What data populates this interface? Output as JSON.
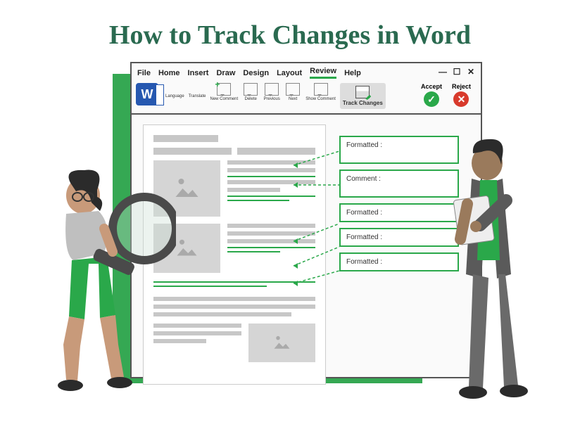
{
  "title": "How to Track Changes in Word",
  "menu": {
    "items": [
      "File",
      "Home",
      "Insert",
      "Draw",
      "Design",
      "Layout",
      "Review",
      "Help"
    ],
    "active_index": 6
  },
  "window_controls": {
    "min": "—",
    "max": "☐",
    "close": "✕"
  },
  "toolbar": {
    "logo_letter": "W",
    "language": "Language",
    "translate": "Translate",
    "new_comment": "New Comment",
    "delete": "Delete",
    "previous": "Previous",
    "next": "Next",
    "show_comment": "Show Comment",
    "track_changes": "Track Changes",
    "accept": "Accept",
    "reject": "Reject"
  },
  "balloons": [
    {
      "label": "Formatted :"
    },
    {
      "label": "Comment :"
    },
    {
      "label": "Formatted :"
    },
    {
      "label": "Formatted :"
    },
    {
      "label": "Formatted :"
    }
  ],
  "colors": {
    "accent_green": "#2aa84a",
    "title_green": "#2a6a50",
    "reject_red": "#d83a2c",
    "word_blue": "#2658b0"
  }
}
